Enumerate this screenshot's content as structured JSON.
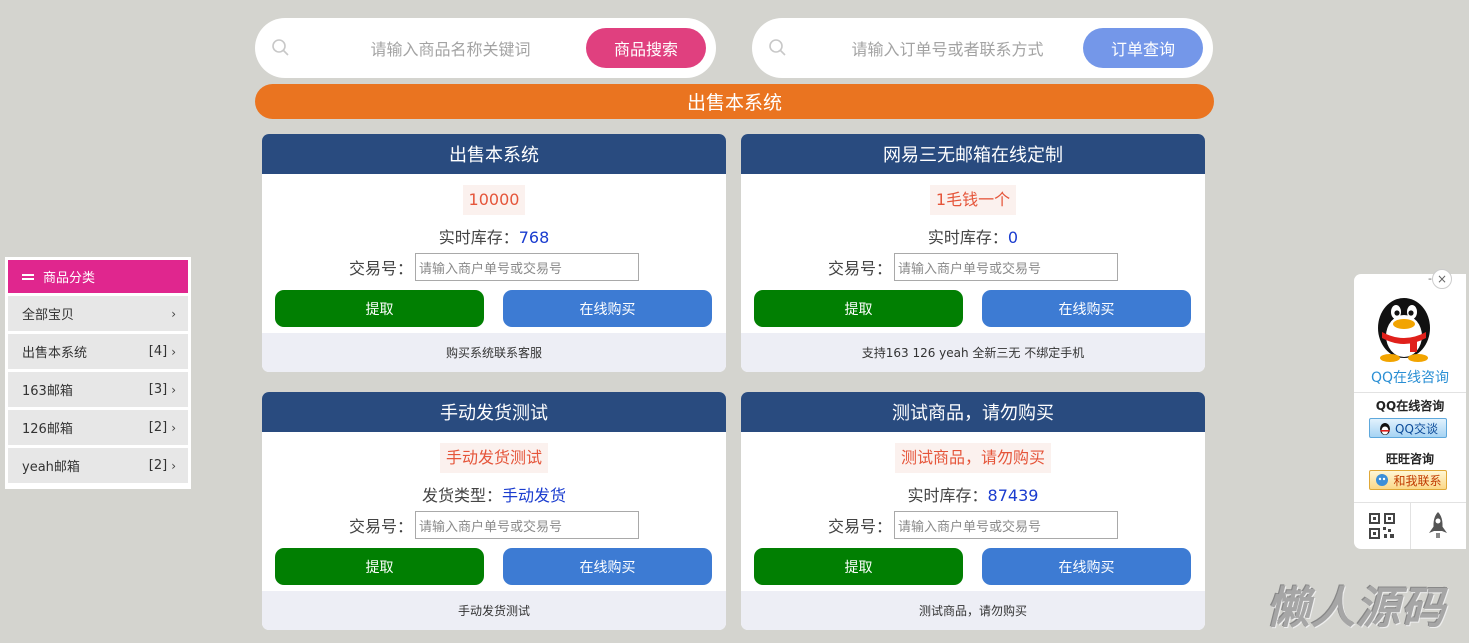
{
  "goods_search": {
    "placeholder": "请输入商品名称关键词",
    "button": "商品搜索"
  },
  "order_search": {
    "placeholder": "请输入订单号或者联系方式",
    "button": "订单查询"
  },
  "banner": {
    "title": "出售本系统"
  },
  "cards": [
    {
      "title": "出售本系统",
      "price": "10000",
      "info_label": "实时库存：",
      "info_value": "768",
      "trade_label": "交易号：",
      "trade_placeholder": "请输入商户单号或交易号",
      "extract_button": "提取",
      "buy_button": "在线购买",
      "footer": "购买系统联系客服"
    },
    {
      "title": "网易三无邮箱在线定制",
      "price": "1毛钱一个",
      "info_label": "实时库存：",
      "info_value": "0",
      "trade_label": "交易号：",
      "trade_placeholder": "请输入商户单号或交易号",
      "extract_button": "提取",
      "buy_button": "在线购买",
      "footer": "支持163 126 yeah 全新三无 不绑定手机"
    },
    {
      "title": "手动发货测试",
      "price": "手动发货测试",
      "info_label": "发货类型：",
      "info_value": "手动发货",
      "trade_label": "交易号：",
      "trade_placeholder": "请输入商户单号或交易号",
      "extract_button": "提取",
      "buy_button": "在线购买",
      "footer": "手动发货测试"
    },
    {
      "title": "测试商品，请勿购买",
      "price": "测试商品，请勿购买",
      "info_label": "实时库存：",
      "info_value": "87439",
      "trade_label": "交易号：",
      "trade_placeholder": "请输入商户单号或交易号",
      "extract_button": "提取",
      "buy_button": "在线购买",
      "footer": "测试商品，请勿购买"
    }
  ],
  "category": {
    "title": "商品分类",
    "items": [
      {
        "label": "全部宝贝",
        "count": ""
      },
      {
        "label": "出售本系统",
        "count": "[4]"
      },
      {
        "label": "163邮箱",
        "count": "[3]"
      },
      {
        "label": "126邮箱",
        "count": "[2]"
      },
      {
        "label": "yeah邮箱",
        "count": "[2]"
      }
    ]
  },
  "qq_panel": {
    "close": "×",
    "dash": "-",
    "title": "QQ在线咨询",
    "qq_label": "QQ在线咨询",
    "qq_button": "QQ交谈",
    "ww_label": "旺旺咨询",
    "ww_button": "和我联系"
  },
  "watermark": "懒人源码",
  "colors": {
    "page_bg": "#d4d4cf",
    "accent_pink": "#e0407f",
    "accent_blue": "#7497e9",
    "banner_orange": "#ea7420",
    "card_header": "#294b7f",
    "extract_green": "#017f02",
    "buy_blue": "#3d7bd3",
    "category_magenta": "#e0268e"
  }
}
